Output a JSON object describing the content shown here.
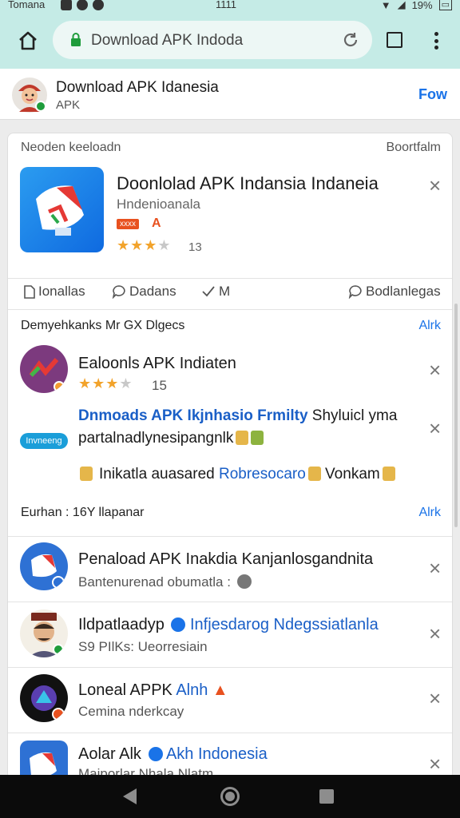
{
  "status_bar": {
    "carrier": "Tomana",
    "time": "1111",
    "battery": "19%"
  },
  "browser": {
    "url": "Download APK Indoda"
  },
  "site": {
    "title": "Download APK Idanesia",
    "subtitle": "APK",
    "follow_label": "Fow"
  },
  "card": {
    "top_left": "Neoden keeloadn",
    "top_right": "Boortfalm",
    "featured": {
      "title": "Doonlolad APK Indansia Indaneia",
      "subtitle": "Hndenioanala",
      "badge": "xxxx",
      "badge_letter": "A",
      "rating": 3,
      "rating_count": "13"
    },
    "actions": [
      {
        "label": "Ionallas",
        "icon": "document-icon"
      },
      {
        "label": "Dadans",
        "icon": "chat-icon"
      },
      {
        "label": "M",
        "icon": "check-icon"
      },
      {
        "label": "Bodlanlegas",
        "icon": "chat-icon"
      }
    ],
    "section1": {
      "heading": "Demyehkanks Mr GX Dlgecs",
      "link": "Alrk",
      "item": {
        "title": "Ealoonls APK Indiaten",
        "rating": 3,
        "count": "15"
      },
      "promo": {
        "pill": "Invneeng",
        "line1_blue": "Dnmoads APK Ikjnhasio Frmilty",
        "line1_rest": " Shyluicl yma",
        "line2": "partalnadlynesipangnlk",
        "line3_a": "Inikatla auasared ",
        "line3_blue": "Robresocaro",
        "line3_c": " Vonkam"
      }
    },
    "section2": {
      "heading": "Eurhan : 16Y llapanar",
      "link": "Alrk",
      "items": [
        {
          "title": "Penaload APK Inakdia Kanjanlosgandnita",
          "subtitle": "Bantenurenad obumatla :"
        },
        {
          "title": "Ildpatlaadyp",
          "title_blue": "Infjesdarog Ndegssiatlanla",
          "subtitle": "S9 PIlKs: Ueorresiain"
        },
        {
          "title": "Loneal APPK",
          "title_blue": "Alnh",
          "subtitle": "Cemina nderkcay"
        },
        {
          "title": "Aolar Alk",
          "title_blue": "Akh Indonesia",
          "subtitle": "Maiporlar Nhala Nlatm"
        }
      ]
    }
  }
}
